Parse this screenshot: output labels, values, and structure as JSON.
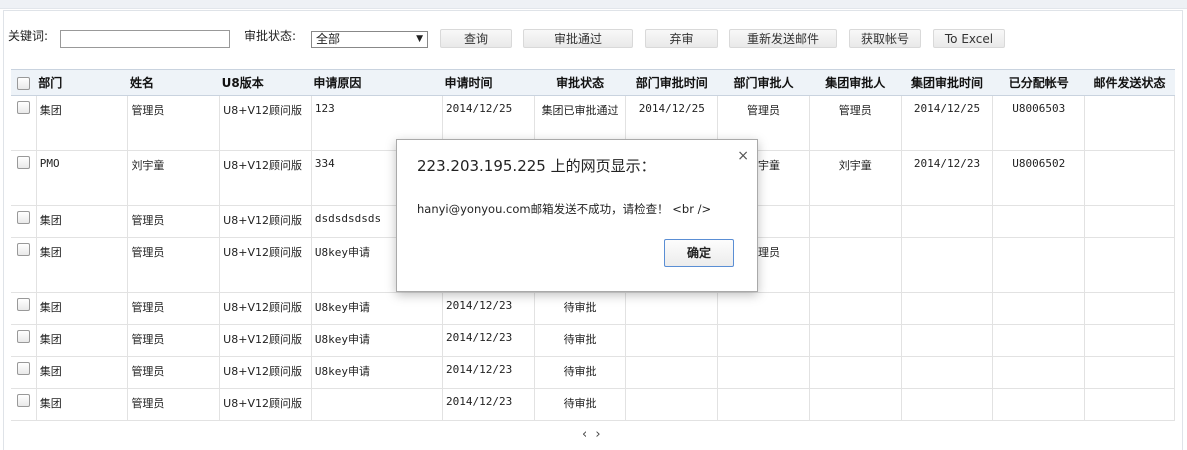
{
  "toolbar": {
    "keyword_label": "关键词:",
    "keyword_value": "",
    "status_label": "审批状态:",
    "status_selected": "全部",
    "buttons": {
      "query": "查询",
      "approve": "审批通过",
      "abandon": "弃审",
      "resend": "重新发送邮件",
      "get_account": "获取帐号",
      "excel": "To Excel"
    }
  },
  "table": {
    "columns": [
      "部门",
      "姓名",
      "U8版本",
      "申请原因",
      "申请时间",
      "审批状态",
      "部门审批时间",
      "部门审批人",
      "集团审批人",
      "集团审批时间",
      "已分配帐号",
      "邮件发送状态"
    ],
    "rows": [
      {
        "dept": "集团",
        "name": "管理员",
        "version": "U8+V12顾问版",
        "reason": "123",
        "time": "2014/12/25",
        "status": "集团已审批通过",
        "dept_time": "2014/12/25",
        "dept_approver": "管理员",
        "group_approver": "管理员",
        "group_time": "2014/12/25",
        "account": "U8006503",
        "mail": ""
      },
      {
        "dept": "PMO",
        "name": "刘宇童",
        "version": "U8+V12顾问版",
        "reason": "334",
        "time": "",
        "status": "",
        "dept_time": "",
        "dept_approver": "刘宇童",
        "group_approver": "刘宇童",
        "group_time": "2014/12/23",
        "account": "U8006502",
        "mail": ""
      },
      {
        "dept": "集团",
        "name": "管理员",
        "version": "U8+V12顾问版",
        "reason": "dsdsdsdsds",
        "time": "",
        "status": "",
        "dept_time": "",
        "dept_approver": "",
        "group_approver": "",
        "group_time": "",
        "account": "",
        "mail": ""
      },
      {
        "dept": "集团",
        "name": "管理员",
        "version": "U8+V12顾问版",
        "reason": "U8key申请",
        "time": "",
        "status": "",
        "dept_time": "",
        "dept_approver": "管理员",
        "group_approver": "",
        "group_time": "",
        "account": "",
        "mail": ""
      },
      {
        "dept": "集团",
        "name": "管理员",
        "version": "U8+V12顾问版",
        "reason": "U8key申请",
        "time": "2014/12/23",
        "status": "待审批",
        "dept_time": "",
        "dept_approver": "",
        "group_approver": "",
        "group_time": "",
        "account": "",
        "mail": ""
      },
      {
        "dept": "集团",
        "name": "管理员",
        "version": "U8+V12顾问版",
        "reason": "U8key申请",
        "time": "2014/12/23",
        "status": "待审批",
        "dept_time": "",
        "dept_approver": "",
        "group_approver": "",
        "group_time": "",
        "account": "",
        "mail": ""
      },
      {
        "dept": "集团",
        "name": "管理员",
        "version": "U8+V12顾问版",
        "reason": "U8key申请",
        "time": "2014/12/23",
        "status": "待审批",
        "dept_time": "",
        "dept_approver": "",
        "group_approver": "",
        "group_time": "",
        "account": "",
        "mail": ""
      },
      {
        "dept": "集团",
        "name": "管理员",
        "version": "U8+V12顾问版",
        "reason": "",
        "time": "2014/12/23",
        "status": "待审批",
        "dept_time": "",
        "dept_approver": "",
        "group_approver": "",
        "group_time": "",
        "account": "",
        "mail": ""
      }
    ]
  },
  "pager": "‹ ›",
  "dialog": {
    "title": "223.203.195.225 上的网页显示：",
    "message": "hanyi@yonyou.com邮箱发送不成功，请检查！ <br />",
    "ok_label": "确定",
    "close_symbol": "×"
  }
}
